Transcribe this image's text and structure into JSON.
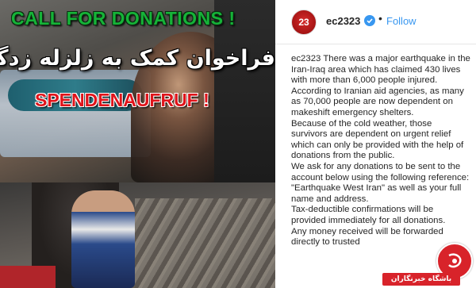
{
  "image": {
    "banner_top": "CALL FOR DONATIONS !",
    "banner_persian": "فراخوان کمک به زلزله زدگان",
    "banner_german": "SPENDENAUFRUF !"
  },
  "post": {
    "username": "ec2323",
    "avatar_text": "23",
    "dot": "•",
    "follow_label": "Follow",
    "caption_user": "ec2323",
    "caption_paragraphs": [
      "There was a major earthquake in the Iran-Iraq area which has claimed 430 lives with more than 6,000 people injured.",
      "According to Iranian aid agencies, as many as 70,000 people are now dependent on makeshift emergency shelters.",
      "Because of the cold weather, those survivors are dependent on urgent relief which can only be provided with the help of donations from the public.",
      "We ask for any donations to be sent to the account below using the following reference: \"Earthquake West Iran\" as well as your full name and address.",
      "Tax-deductible confirmations will be provided immediately for all donations.",
      "Any money received will be forwarded directly to trusted"
    ]
  },
  "watermark": {
    "text": "باشگاه خبرنگاران"
  },
  "colors": {
    "follow": "#3897f0",
    "banner_green": "#16b338",
    "banner_red": "#e0141b",
    "watermark_red": "#d8232a"
  },
  "icons": [
    "verified-badge-icon",
    "clubs-logo-icon"
  ]
}
